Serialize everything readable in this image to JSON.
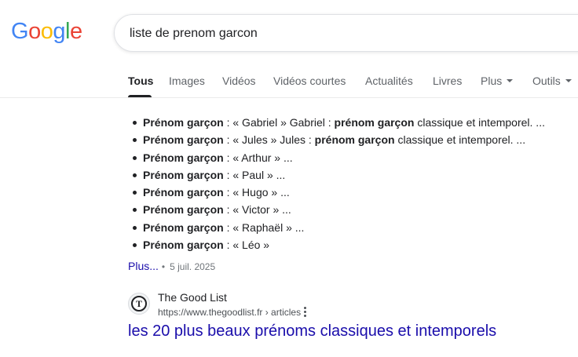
{
  "logo": {
    "letters": [
      "G",
      "o",
      "o",
      "g",
      "l",
      "e"
    ],
    "colors": [
      "#4285F4",
      "#EA4335",
      "#FBBC05",
      "#4285F4",
      "#34A853",
      "#EA4335"
    ]
  },
  "search": {
    "query": "liste de prenom garcon"
  },
  "tabs": [
    {
      "label": "Tous",
      "active": true
    },
    {
      "label": "Images"
    },
    {
      "label": "Vidéos"
    },
    {
      "label": "Vidéos courtes"
    },
    {
      "label": "Actualités"
    },
    {
      "label": "Livres"
    },
    {
      "label": "Plus"
    },
    {
      "label": "Outils"
    }
  ],
  "bullets": [
    {
      "bold1": "Prénom garçon",
      "text1": " : « Gabriel » Gabriel : ",
      "bold2": "prénom garçon",
      "text2": " classique et intemporel. ..."
    },
    {
      "bold1": "Prénom garçon",
      "text1": " : « Jules » Jules : ",
      "bold2": "prénom garçon",
      "text2": " classique et intemporel. ..."
    },
    {
      "bold1": "Prénom garçon",
      "text1": " : « Arthur » ...",
      "bold2": "",
      "text2": ""
    },
    {
      "bold1": "Prénom garçon",
      "text1": " : « Paul » ...",
      "bold2": "",
      "text2": ""
    },
    {
      "bold1": "Prénom garçon",
      "text1": " : « Hugo » ...",
      "bold2": "",
      "text2": ""
    },
    {
      "bold1": "Prénom garçon",
      "text1": " : « Victor » ...",
      "bold2": "",
      "text2": ""
    },
    {
      "bold1": "Prénom garçon",
      "text1": " : « Raphaël » ...",
      "bold2": "",
      "text2": ""
    },
    {
      "bold1": "Prénom garçon",
      "text1": " : « Léo »",
      "bold2": "",
      "text2": ""
    }
  ],
  "snippet_meta": {
    "more_label": "Plus...",
    "separator": "•",
    "date": "5 juil. 2025"
  },
  "result": {
    "favicon_letter": "T",
    "favicon_icon": "the-good-list-favicon",
    "site_name": "The Good List",
    "url": "https://www.thegoodlist.fr › articles",
    "title": "les 20 plus beaux prénoms classiques et intemporels"
  },
  "colors": {
    "link": "#1a0dab",
    "text": "#202124",
    "muted": "#5f6368"
  }
}
